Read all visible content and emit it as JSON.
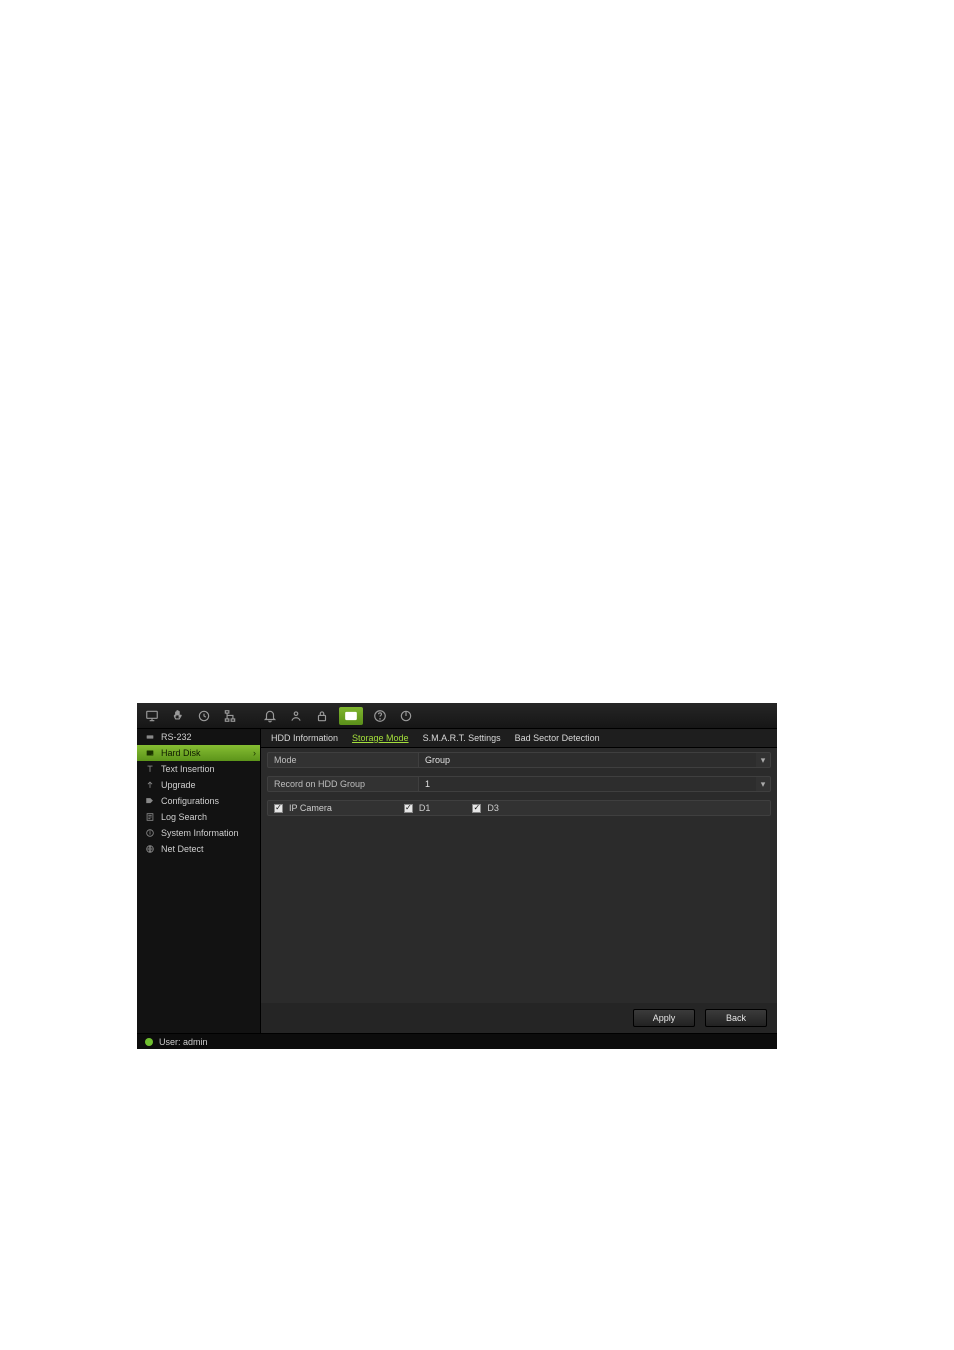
{
  "sidebar": {
    "items": [
      {
        "icon": "port",
        "label": "RS-232"
      },
      {
        "icon": "disk",
        "label": "Hard Disk"
      },
      {
        "icon": "text",
        "label": "Text Insertion"
      },
      {
        "icon": "up",
        "label": "Upgrade"
      },
      {
        "icon": "cfg",
        "label": "Configurations"
      },
      {
        "icon": "log",
        "label": "Log Search"
      },
      {
        "icon": "info",
        "label": "System Information"
      },
      {
        "icon": "net",
        "label": "Net Detect"
      }
    ],
    "active_index": 1
  },
  "tabs": {
    "items": [
      {
        "label": "HDD Information"
      },
      {
        "label": "Storage Mode"
      },
      {
        "label": "S.M.A.R.T. Settings"
      },
      {
        "label": "Bad Sector Detection"
      }
    ],
    "active_index": 1
  },
  "form": {
    "mode_label": "Mode",
    "mode_value": "Group",
    "record_group_label": "Record on HDD Group",
    "record_group_value": "1"
  },
  "camera_row": {
    "master_label": "IP Camera",
    "d1": "D1",
    "d3": "D3"
  },
  "buttons": {
    "apply": "Apply",
    "back": "Back"
  },
  "status": {
    "user_label": "User: admin"
  }
}
